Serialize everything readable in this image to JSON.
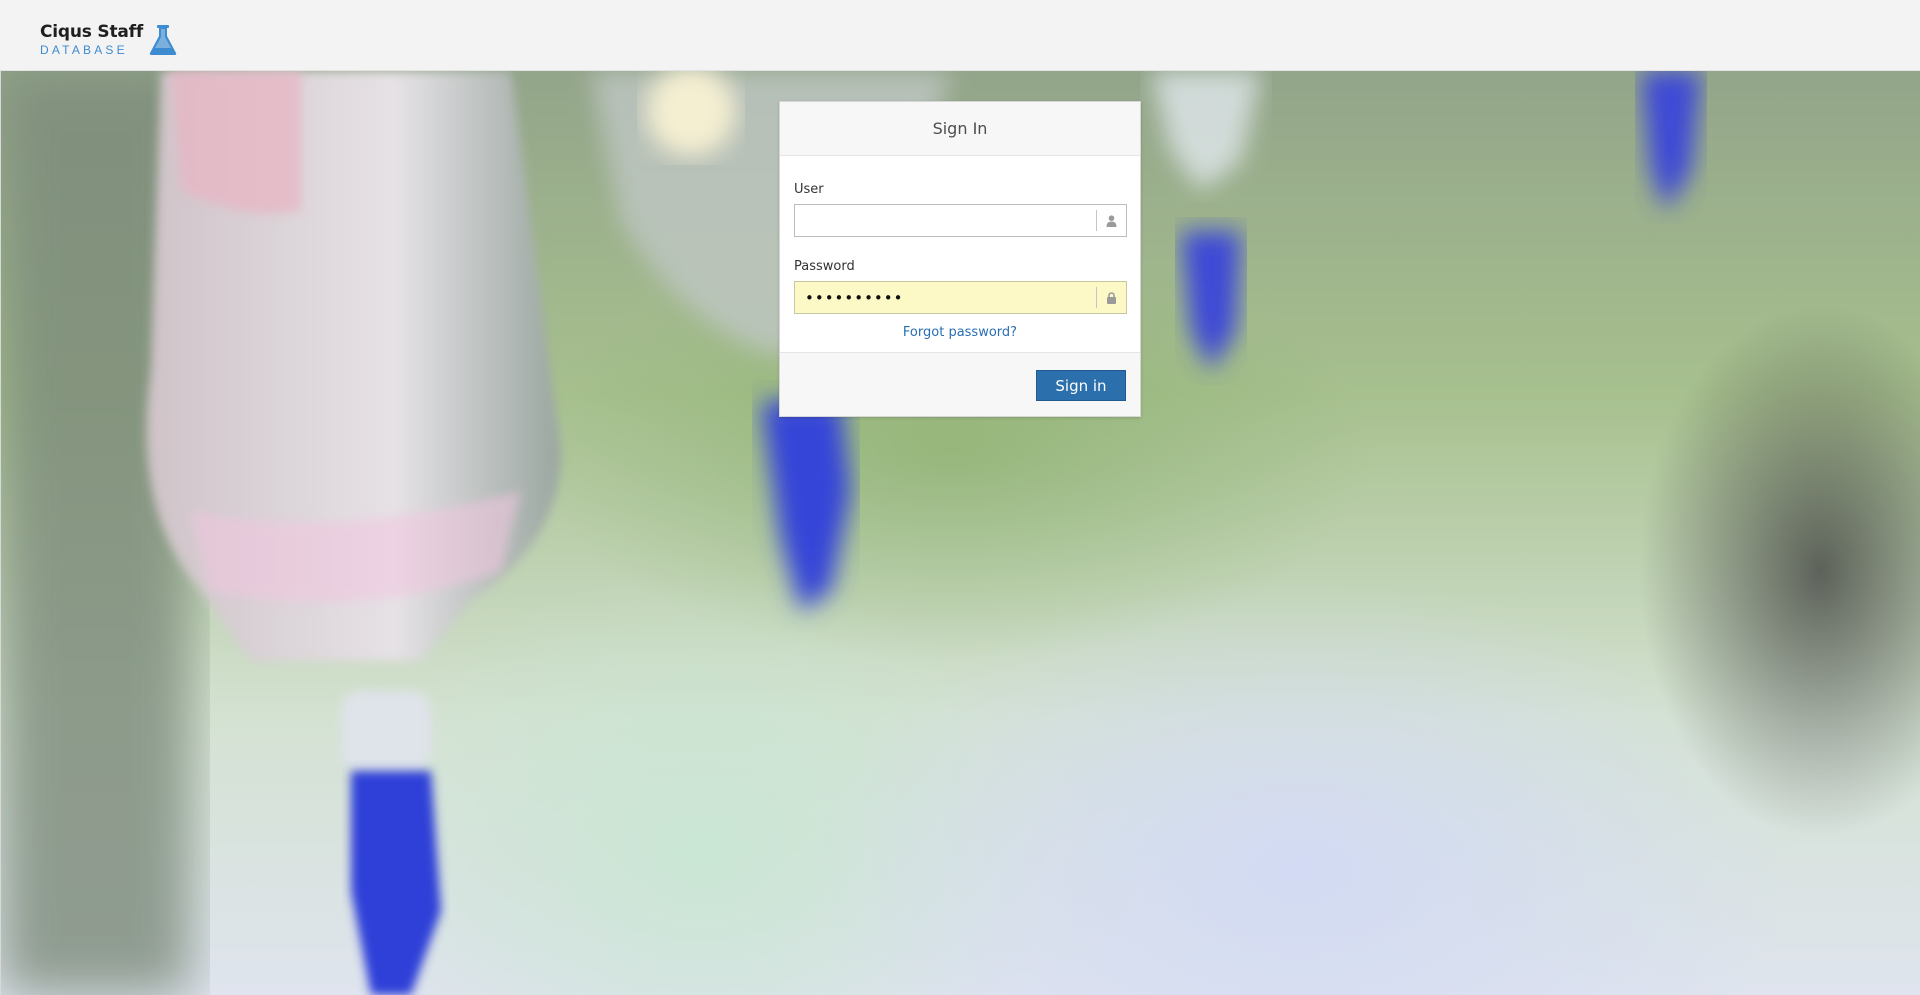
{
  "header": {
    "logo_title": "Ciqus Staff",
    "logo_subtitle": "DATABASE",
    "logo_icon": "flask-icon"
  },
  "login": {
    "title": "Sign In",
    "user_label": "User",
    "user_value": "",
    "user_icon": "user-icon",
    "password_label": "Password",
    "password_value": "••••••••••",
    "password_icon": "lock-icon",
    "forgot_link": "Forgot password?",
    "submit_label": "Sign in"
  },
  "colors": {
    "accent": "#2c6fad",
    "logo_blue": "#3d8bd0",
    "autofill": "#fdf9c6"
  }
}
